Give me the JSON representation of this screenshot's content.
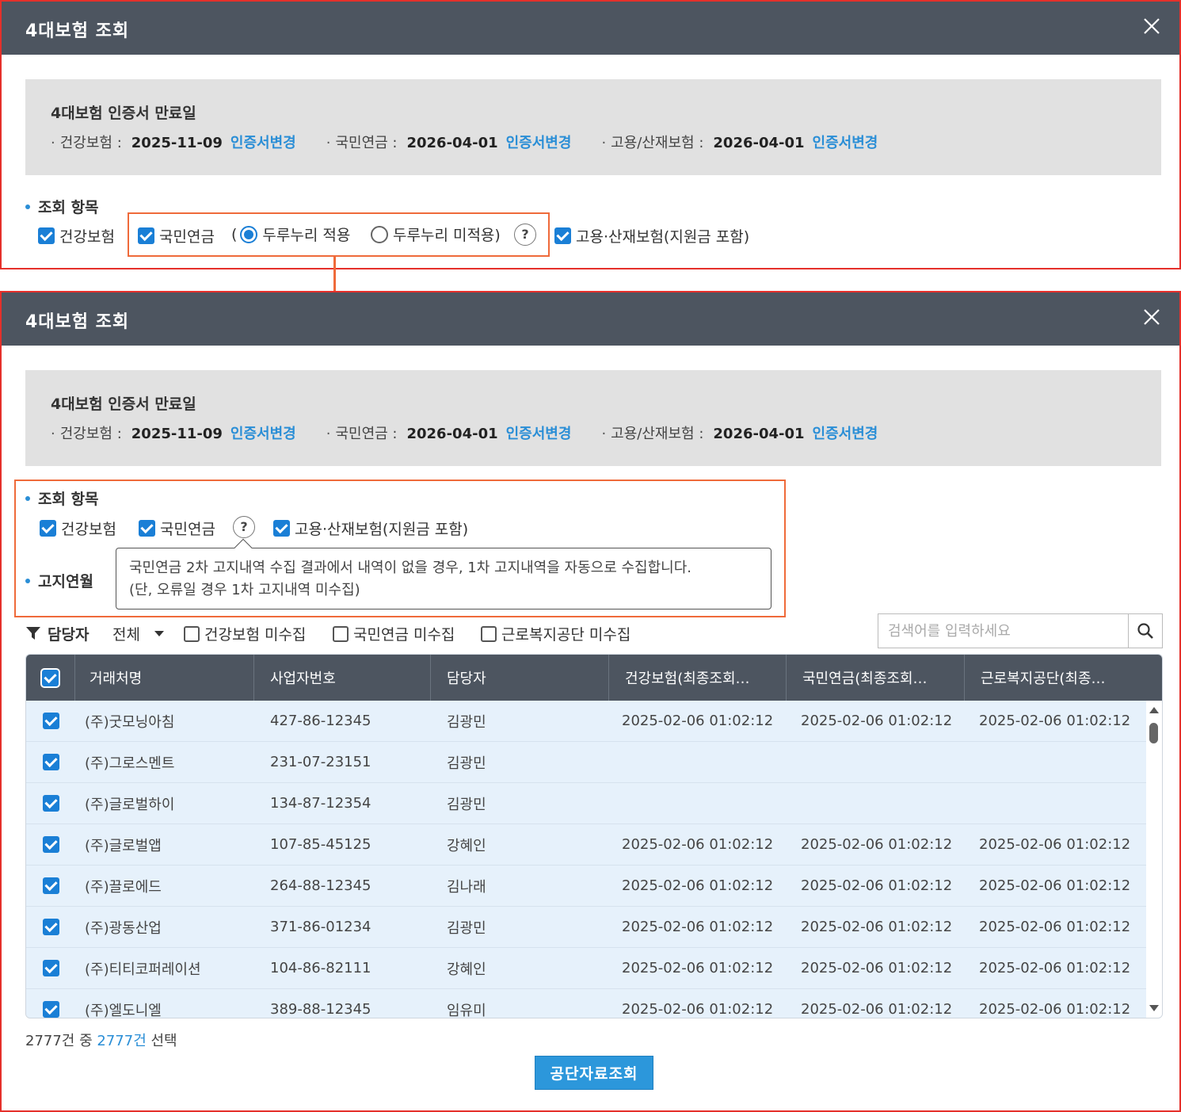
{
  "dialog": {
    "title": "4대보험 조회",
    "close_label": "×"
  },
  "cert": {
    "title": "4대보험 인증서 만료일",
    "bullet": "·",
    "items": [
      {
        "label": "건강보험 :",
        "date": "2025-11-09",
        "link": "인증서변경"
      },
      {
        "label": "국민연금 :",
        "date": "2026-04-01",
        "link": "인증서변경"
      },
      {
        "label": "고용/산재보험 :",
        "date": "2026-04-01",
        "link": "인증서변경"
      }
    ]
  },
  "query_section": {
    "label": "조회 항목",
    "health": "건강보험",
    "pension": "국민연금",
    "pension_open_paren": "(",
    "radio_apply": "두루누리 적용",
    "radio_not_apply": "두루누리 미적용)",
    "help": "?",
    "employment": "고용·산재보험(지원금 포함)"
  },
  "notice_section": {
    "label": "고지연월"
  },
  "tooltip": {
    "line1": "국민연금 2차 고지내역 수집 결과에서 내역이 없을 경우, 1차 고지내역을 자동으로 수집합니다.",
    "line2": "(단, 오류일 경우 1차 고지내역 미수집)"
  },
  "filter": {
    "manager_label": "담당자",
    "manager_value": "전체",
    "uncollected": [
      "건강보험 미수집",
      "국민연금 미수집",
      "근로복지공단 미수집"
    ],
    "search_placeholder": "검색어를 입력하세요"
  },
  "grid": {
    "columns": [
      "거래처명",
      "사업자번호",
      "담당자",
      "건강보험(최종조회…",
      "국민연금(최종조회…",
      "근로복지공단(최종…"
    ],
    "rows": [
      {
        "name": "(주)굿모닝아침",
        "biz": "427-86-12345",
        "mgr": "김광민",
        "health": "2025-02-06 01:02:12",
        "pension": "2025-02-06 01:02:12",
        "welfare": "2025-02-06 01:02:12"
      },
      {
        "name": "(주)그로스멘트",
        "biz": "231-07-23151",
        "mgr": "김광민",
        "health": "",
        "pension": "",
        "welfare": ""
      },
      {
        "name": "(주)글로벌하이",
        "biz": "134-87-12354",
        "mgr": "김광민",
        "health": "",
        "pension": "",
        "welfare": ""
      },
      {
        "name": "(주)글로벌앱",
        "biz": "107-85-45125",
        "mgr": "강혜인",
        "health": "2025-02-06 01:02:12",
        "pension": "2025-02-06 01:02:12",
        "welfare": "2025-02-06 01:02:12"
      },
      {
        "name": "(주)끌로에드",
        "biz": "264-88-12345",
        "mgr": "김나래",
        "health": "2025-02-06 01:02:12",
        "pension": "2025-02-06 01:02:12",
        "welfare": "2025-02-06 01:02:12"
      },
      {
        "name": "(주)광동산업",
        "biz": "371-86-01234",
        "mgr": "김광민",
        "health": "2025-02-06 01:02:12",
        "pension": "2025-02-06 01:02:12",
        "welfare": "2025-02-06 01:02:12"
      },
      {
        "name": "(주)티티코퍼레이션",
        "biz": "104-86-82111",
        "mgr": "강혜인",
        "health": "2025-02-06 01:02:12",
        "pension": "2025-02-06 01:02:12",
        "welfare": "2025-02-06 01:02:12"
      },
      {
        "name": "(주)엘도니엘",
        "biz": "389-88-12345",
        "mgr": "임유미",
        "health": "2025-02-06 01:02:12",
        "pension": "2025-02-06 01:02:12",
        "welfare": "2025-02-06 01:02:12"
      }
    ]
  },
  "summary": {
    "total": "2777건 중",
    "selected": "2777건",
    "suffix": "선택"
  },
  "action": {
    "button": "공단자료조회"
  },
  "colors": {
    "titlebar": "#4d5560",
    "accent": "#2a8ed6",
    "highlight_border": "#ef6a3a",
    "frame_border": "#e5302b",
    "row_bg": "#e6f1fb"
  },
  "icons": [
    "close-icon",
    "help-icon",
    "filter-icon",
    "search-icon",
    "checkbox-icon",
    "radio-icon"
  ]
}
